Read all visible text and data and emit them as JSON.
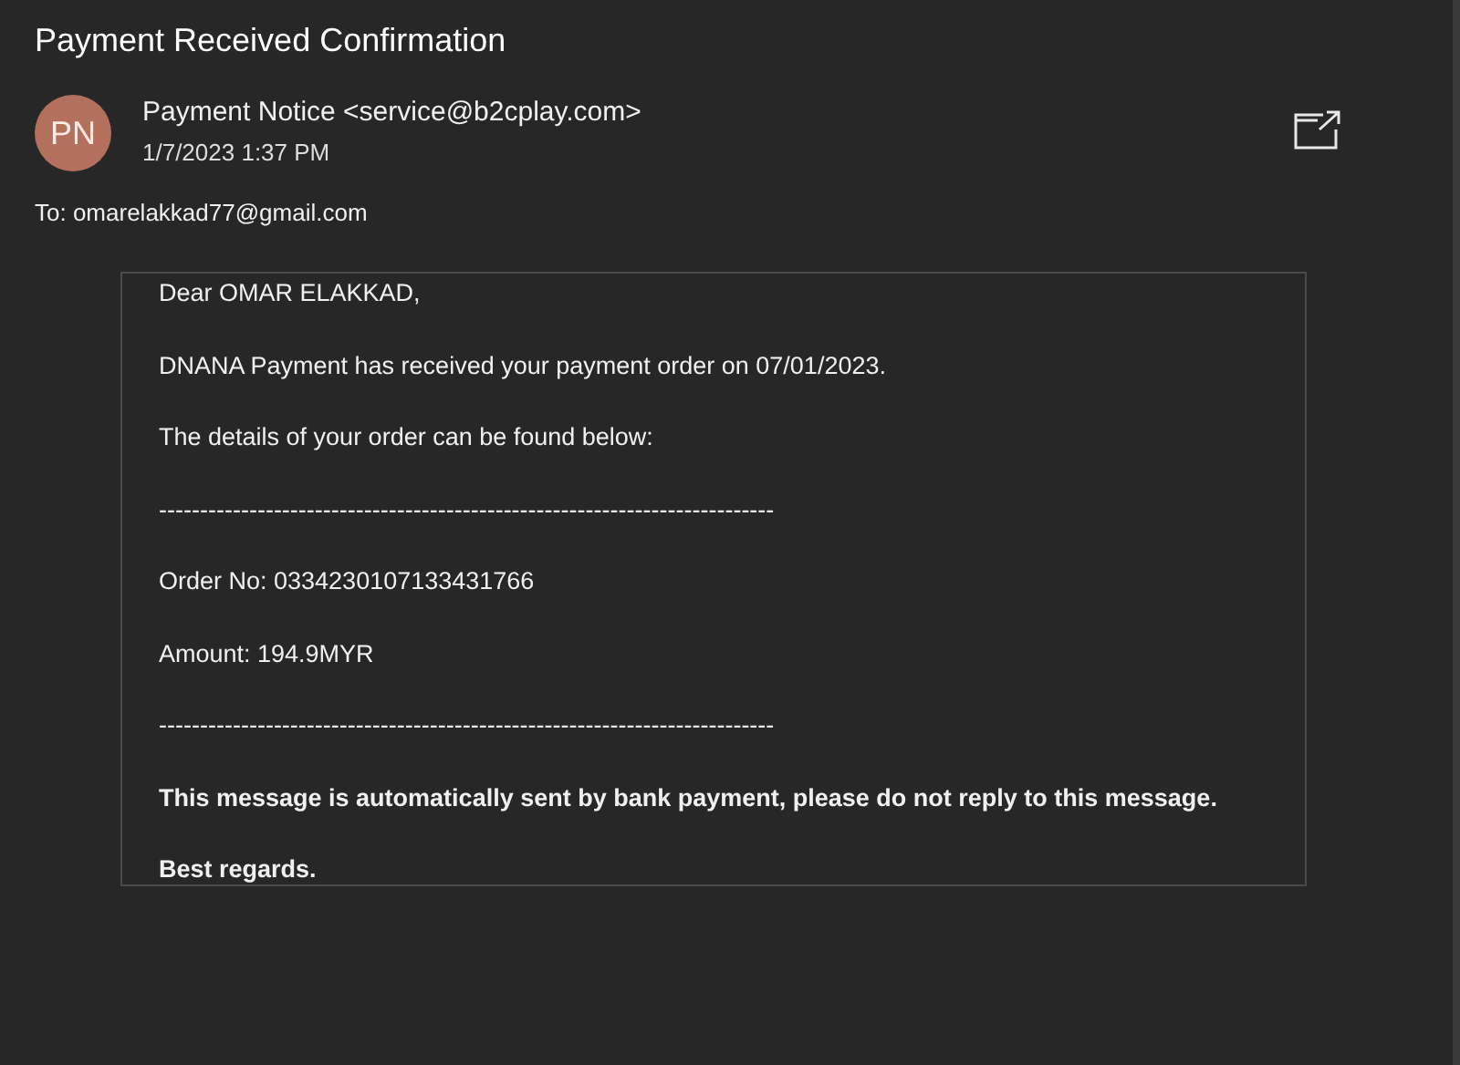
{
  "subject": "Payment Received Confirmation",
  "sender": {
    "initials": "PN",
    "name": "Payment Notice <service@b2cplay.com>",
    "date": "1/7/2023 1:37 PM"
  },
  "to": "To: omarelakkad77@gmail.com",
  "body": [
    {
      "text": "Dear OMAR ELAKKAD,",
      "bold": false
    },
    {
      "text": "DNANA Payment has received your payment order on 07/01/2023.",
      "bold": false
    },
    {
      "text": "The details of your order can be found below:",
      "bold": false
    },
    {
      "text": "---------------------------------------------------------------------------",
      "bold": false
    },
    {
      "text": "Order No: 0334230107133431766",
      "bold": false
    },
    {
      "text": "Amount: 194.9MYR",
      "bold": false
    },
    {
      "text": "---------------------------------------------------------------------------",
      "bold": false
    },
    {
      "text": "This message is automatically sent by bank payment, please do not reply to this message.",
      "bold": true
    },
    {
      "text": "Best regards.",
      "bold": true
    }
  ]
}
